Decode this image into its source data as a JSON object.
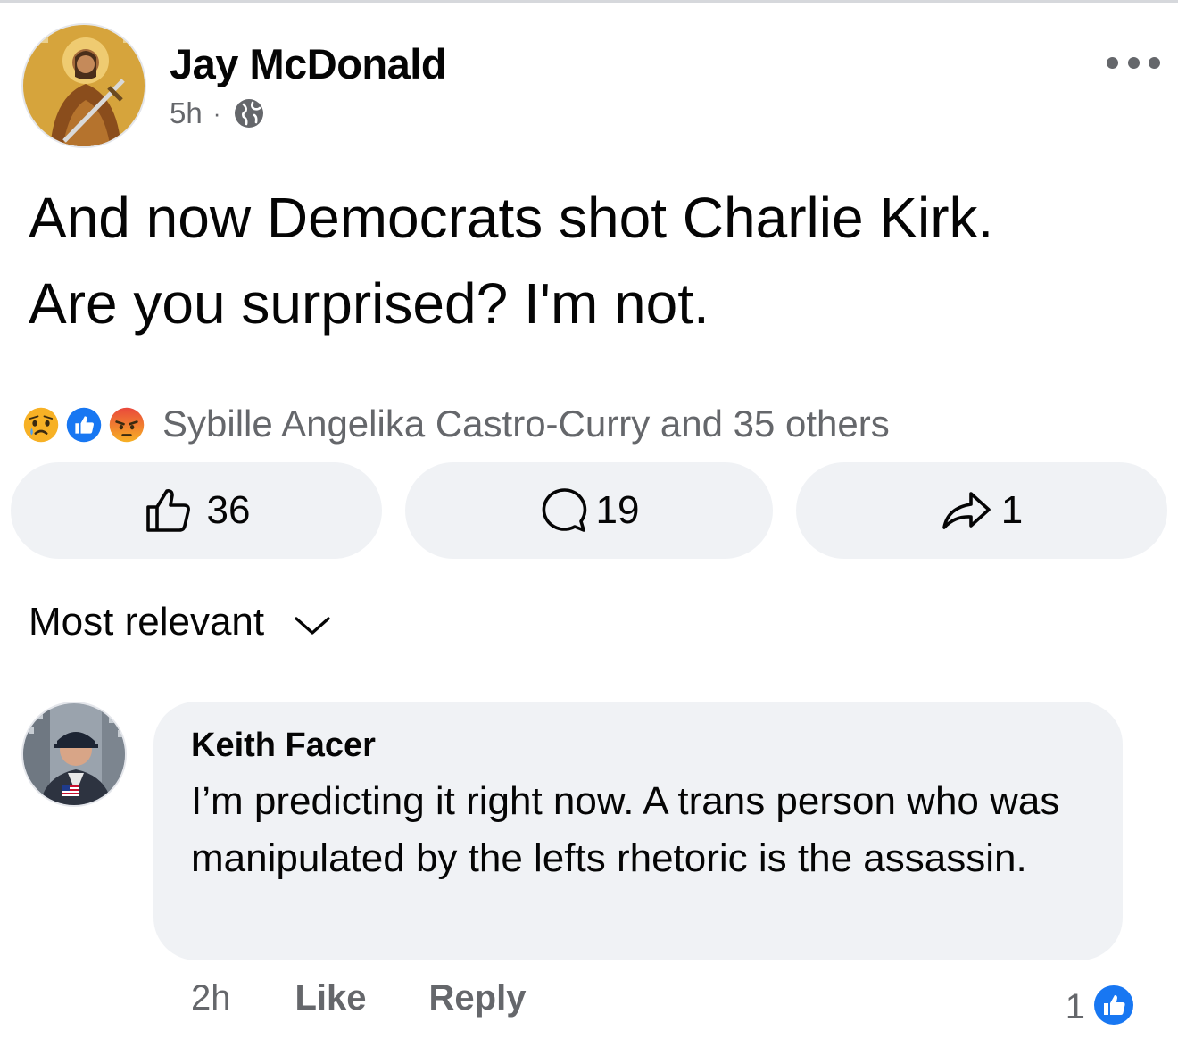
{
  "post": {
    "author": "Jay McDonald",
    "time": "5h",
    "separator": "·",
    "privacy_icon": "globe-icon",
    "text": "And now Democrats shot Charlie Kirk. Are you surprised? I'm not."
  },
  "reactions": {
    "icons": [
      "sad-reaction-icon",
      "like-reaction-icon",
      "angry-reaction-icon"
    ],
    "summary": "Sybille Angelika Castro-Curry and 35 others"
  },
  "actions": {
    "like_count": "36",
    "comment_count": "19",
    "share_count": "1"
  },
  "sort": {
    "label": "Most relevant"
  },
  "comments": [
    {
      "author": "Keith Facer",
      "text": "I’m predicting it right now. A trans person who was manipulated by the lefts rhetoric is the assassin.",
      "time": "2h",
      "like_label": "Like",
      "reply_label": "Reply",
      "reaction_count": "1"
    }
  ],
  "colors": {
    "facebook_blue": "#1877f2",
    "secondary_text": "#65676b",
    "button_bg": "#f0f2f5",
    "reaction_yellow": "#f7b125",
    "angry_orange": "#e9710f"
  }
}
